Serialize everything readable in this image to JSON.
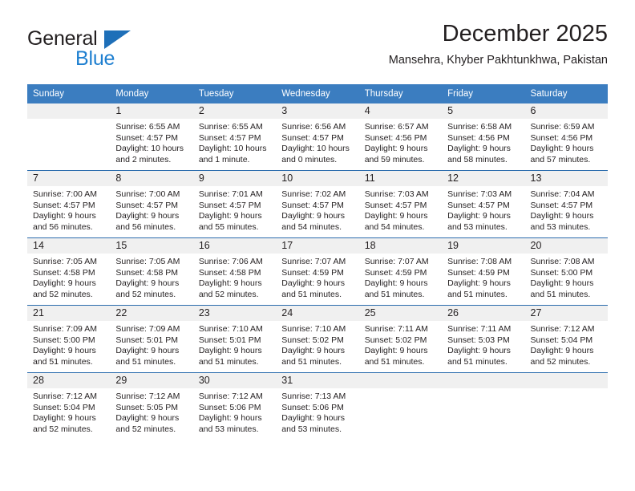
{
  "brand": {
    "name_top": "General",
    "name_bottom": "Blue",
    "triangle_color": "#1e6fb8",
    "blue_color": "#1e7fd0"
  },
  "header": {
    "title": "December 2025",
    "subtitle": "Mansehra, Khyber Pakhtunkhwa, Pakistan"
  },
  "colors": {
    "header_bar": "#3b7dc0",
    "week_separator": "#2b6cad",
    "daynum_band": "#f0f0f0",
    "text": "#231f20"
  },
  "weekday_headers": [
    "Sunday",
    "Monday",
    "Tuesday",
    "Wednesday",
    "Thursday",
    "Friday",
    "Saturday"
  ],
  "weeks": [
    [
      {
        "day": "",
        "sunrise": "",
        "sunset": "",
        "daylight_line1": "",
        "daylight_line2": ""
      },
      {
        "day": "1",
        "sunrise": "Sunrise: 6:55 AM",
        "sunset": "Sunset: 4:57 PM",
        "daylight_line1": "Daylight: 10 hours",
        "daylight_line2": "and 2 minutes."
      },
      {
        "day": "2",
        "sunrise": "Sunrise: 6:55 AM",
        "sunset": "Sunset: 4:57 PM",
        "daylight_line1": "Daylight: 10 hours",
        "daylight_line2": "and 1 minute."
      },
      {
        "day": "3",
        "sunrise": "Sunrise: 6:56 AM",
        "sunset": "Sunset: 4:57 PM",
        "daylight_line1": "Daylight: 10 hours",
        "daylight_line2": "and 0 minutes."
      },
      {
        "day": "4",
        "sunrise": "Sunrise: 6:57 AM",
        "sunset": "Sunset: 4:56 PM",
        "daylight_line1": "Daylight: 9 hours",
        "daylight_line2": "and 59 minutes."
      },
      {
        "day": "5",
        "sunrise": "Sunrise: 6:58 AM",
        "sunset": "Sunset: 4:56 PM",
        "daylight_line1": "Daylight: 9 hours",
        "daylight_line2": "and 58 minutes."
      },
      {
        "day": "6",
        "sunrise": "Sunrise: 6:59 AM",
        "sunset": "Sunset: 4:56 PM",
        "daylight_line1": "Daylight: 9 hours",
        "daylight_line2": "and 57 minutes."
      }
    ],
    [
      {
        "day": "7",
        "sunrise": "Sunrise: 7:00 AM",
        "sunset": "Sunset: 4:57 PM",
        "daylight_line1": "Daylight: 9 hours",
        "daylight_line2": "and 56 minutes."
      },
      {
        "day": "8",
        "sunrise": "Sunrise: 7:00 AM",
        "sunset": "Sunset: 4:57 PM",
        "daylight_line1": "Daylight: 9 hours",
        "daylight_line2": "and 56 minutes."
      },
      {
        "day": "9",
        "sunrise": "Sunrise: 7:01 AM",
        "sunset": "Sunset: 4:57 PM",
        "daylight_line1": "Daylight: 9 hours",
        "daylight_line2": "and 55 minutes."
      },
      {
        "day": "10",
        "sunrise": "Sunrise: 7:02 AM",
        "sunset": "Sunset: 4:57 PM",
        "daylight_line1": "Daylight: 9 hours",
        "daylight_line2": "and 54 minutes."
      },
      {
        "day": "11",
        "sunrise": "Sunrise: 7:03 AM",
        "sunset": "Sunset: 4:57 PM",
        "daylight_line1": "Daylight: 9 hours",
        "daylight_line2": "and 54 minutes."
      },
      {
        "day": "12",
        "sunrise": "Sunrise: 7:03 AM",
        "sunset": "Sunset: 4:57 PM",
        "daylight_line1": "Daylight: 9 hours",
        "daylight_line2": "and 53 minutes."
      },
      {
        "day": "13",
        "sunrise": "Sunrise: 7:04 AM",
        "sunset": "Sunset: 4:57 PM",
        "daylight_line1": "Daylight: 9 hours",
        "daylight_line2": "and 53 minutes."
      }
    ],
    [
      {
        "day": "14",
        "sunrise": "Sunrise: 7:05 AM",
        "sunset": "Sunset: 4:58 PM",
        "daylight_line1": "Daylight: 9 hours",
        "daylight_line2": "and 52 minutes."
      },
      {
        "day": "15",
        "sunrise": "Sunrise: 7:05 AM",
        "sunset": "Sunset: 4:58 PM",
        "daylight_line1": "Daylight: 9 hours",
        "daylight_line2": "and 52 minutes."
      },
      {
        "day": "16",
        "sunrise": "Sunrise: 7:06 AM",
        "sunset": "Sunset: 4:58 PM",
        "daylight_line1": "Daylight: 9 hours",
        "daylight_line2": "and 52 minutes."
      },
      {
        "day": "17",
        "sunrise": "Sunrise: 7:07 AM",
        "sunset": "Sunset: 4:59 PM",
        "daylight_line1": "Daylight: 9 hours",
        "daylight_line2": "and 51 minutes."
      },
      {
        "day": "18",
        "sunrise": "Sunrise: 7:07 AM",
        "sunset": "Sunset: 4:59 PM",
        "daylight_line1": "Daylight: 9 hours",
        "daylight_line2": "and 51 minutes."
      },
      {
        "day": "19",
        "sunrise": "Sunrise: 7:08 AM",
        "sunset": "Sunset: 4:59 PM",
        "daylight_line1": "Daylight: 9 hours",
        "daylight_line2": "and 51 minutes."
      },
      {
        "day": "20",
        "sunrise": "Sunrise: 7:08 AM",
        "sunset": "Sunset: 5:00 PM",
        "daylight_line1": "Daylight: 9 hours",
        "daylight_line2": "and 51 minutes."
      }
    ],
    [
      {
        "day": "21",
        "sunrise": "Sunrise: 7:09 AM",
        "sunset": "Sunset: 5:00 PM",
        "daylight_line1": "Daylight: 9 hours",
        "daylight_line2": "and 51 minutes."
      },
      {
        "day": "22",
        "sunrise": "Sunrise: 7:09 AM",
        "sunset": "Sunset: 5:01 PM",
        "daylight_line1": "Daylight: 9 hours",
        "daylight_line2": "and 51 minutes."
      },
      {
        "day": "23",
        "sunrise": "Sunrise: 7:10 AM",
        "sunset": "Sunset: 5:01 PM",
        "daylight_line1": "Daylight: 9 hours",
        "daylight_line2": "and 51 minutes."
      },
      {
        "day": "24",
        "sunrise": "Sunrise: 7:10 AM",
        "sunset": "Sunset: 5:02 PM",
        "daylight_line1": "Daylight: 9 hours",
        "daylight_line2": "and 51 minutes."
      },
      {
        "day": "25",
        "sunrise": "Sunrise: 7:11 AM",
        "sunset": "Sunset: 5:02 PM",
        "daylight_line1": "Daylight: 9 hours",
        "daylight_line2": "and 51 minutes."
      },
      {
        "day": "26",
        "sunrise": "Sunrise: 7:11 AM",
        "sunset": "Sunset: 5:03 PM",
        "daylight_line1": "Daylight: 9 hours",
        "daylight_line2": "and 51 minutes."
      },
      {
        "day": "27",
        "sunrise": "Sunrise: 7:12 AM",
        "sunset": "Sunset: 5:04 PM",
        "daylight_line1": "Daylight: 9 hours",
        "daylight_line2": "and 52 minutes."
      }
    ],
    [
      {
        "day": "28",
        "sunrise": "Sunrise: 7:12 AM",
        "sunset": "Sunset: 5:04 PM",
        "daylight_line1": "Daylight: 9 hours",
        "daylight_line2": "and 52 minutes."
      },
      {
        "day": "29",
        "sunrise": "Sunrise: 7:12 AM",
        "sunset": "Sunset: 5:05 PM",
        "daylight_line1": "Daylight: 9 hours",
        "daylight_line2": "and 52 minutes."
      },
      {
        "day": "30",
        "sunrise": "Sunrise: 7:12 AM",
        "sunset": "Sunset: 5:06 PM",
        "daylight_line1": "Daylight: 9 hours",
        "daylight_line2": "and 53 minutes."
      },
      {
        "day": "31",
        "sunrise": "Sunrise: 7:13 AM",
        "sunset": "Sunset: 5:06 PM",
        "daylight_line1": "Daylight: 9 hours",
        "daylight_line2": "and 53 minutes."
      },
      {
        "day": "",
        "sunrise": "",
        "sunset": "",
        "daylight_line1": "",
        "daylight_line2": ""
      },
      {
        "day": "",
        "sunrise": "",
        "sunset": "",
        "daylight_line1": "",
        "daylight_line2": ""
      },
      {
        "day": "",
        "sunrise": "",
        "sunset": "",
        "daylight_line1": "",
        "daylight_line2": ""
      }
    ]
  ]
}
